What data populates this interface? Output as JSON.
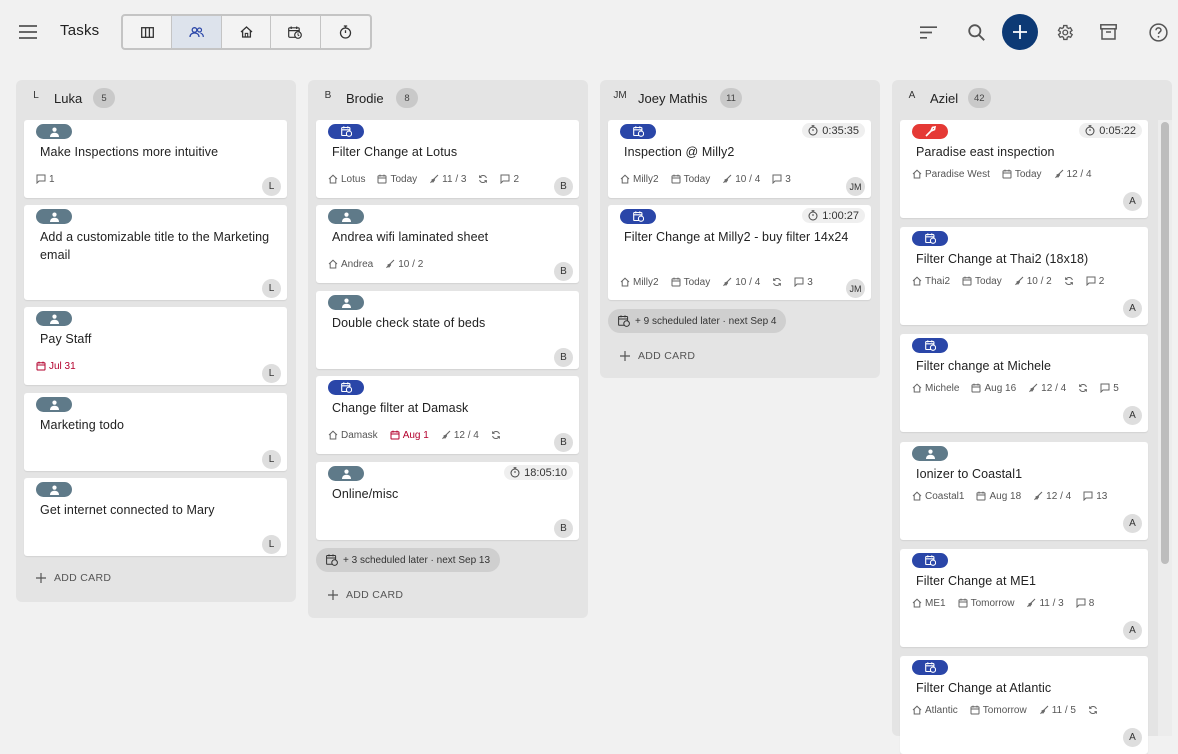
{
  "app": {
    "title": "Tasks",
    "brand_color": "#0d3a75"
  },
  "toolbar": {
    "view_icons": [
      "board-icon",
      "people-icon",
      "home-icon",
      "calendar-clock-icon",
      "stopwatch-icon"
    ],
    "active_view": 1,
    "right_icons": [
      "sort-icon",
      "search-icon",
      "add-icon",
      "gear-icon",
      "archive-icon",
      "help-icon"
    ]
  },
  "colors": {
    "pill_person": "#5f7a89",
    "pill_schedule": "#2a46a8",
    "pill_repair": "#e53935",
    "overdue": "#b3002d"
  },
  "columns": [
    {
      "initial": "L",
      "name": "Luka",
      "count": "5",
      "add_label": "ADD CARD",
      "cards": [
        {
          "type": "person",
          "title": "Make Inspections more intuitive",
          "meta": {
            "comments": "1"
          },
          "assignee": "L"
        },
        {
          "type": "person",
          "title": "Add a customizable title to the Marketing email",
          "meta": {},
          "assignee": "L"
        },
        {
          "type": "person",
          "title": "Pay Staff",
          "meta": {
            "date": "Jul 31",
            "date_overdue": true
          },
          "assignee": "L"
        },
        {
          "type": "person",
          "title": "Marketing todo",
          "meta": {},
          "assignee": "L"
        },
        {
          "type": "person",
          "title": "Get internet connected to Mary",
          "meta": {},
          "assignee": "L"
        }
      ]
    },
    {
      "initial": "B",
      "name": "Brodie",
      "count": "8",
      "add_label": "ADD CARD",
      "scheduled": "+ 3 scheduled later · next Sep 13",
      "cards": [
        {
          "type": "schedule",
          "title": "Filter Change at Lotus",
          "meta": {
            "location": "Lotus",
            "date": "Today",
            "checklist": "11 / 3",
            "recurring": true,
            "comments": "2"
          },
          "assignee": "B"
        },
        {
          "type": "person",
          "title": "Andrea wifi laminated sheet",
          "meta": {
            "location": "Andrea",
            "checklist": "10 / 2"
          },
          "assignee": "B"
        },
        {
          "type": "person",
          "title": "Double check state of beds",
          "meta": {},
          "assignee": "B"
        },
        {
          "type": "schedule",
          "title": "Change filter at Damask",
          "meta": {
            "location": "Damask",
            "date": "Aug 1",
            "date_overdue": true,
            "checklist": "12 / 4",
            "recurring": true
          },
          "assignee": "B"
        },
        {
          "type": "person",
          "title": "Online/misc",
          "timer": "18:05:10",
          "meta": {},
          "assignee": "B"
        }
      ]
    },
    {
      "initial": "JM",
      "name": "Joey Mathis",
      "count": "11",
      "add_label": "ADD CARD",
      "scheduled": "+ 9 scheduled later · next Sep 4",
      "cards": [
        {
          "type": "schedule",
          "title": "Inspection @ Milly2",
          "timer": "0:35:35",
          "meta": {
            "location": "Milly2",
            "date": "Today",
            "checklist": "10 / 4",
            "comments": "3"
          },
          "assignee": "JM"
        },
        {
          "type": "schedule",
          "title": "Filter Change at  Milly2 - buy filter 14x24",
          "timer": "1:00:27",
          "meta": {
            "location": "Milly2",
            "date": "Today",
            "checklist": "10 / 4",
            "recurring": true,
            "comments": "3"
          },
          "assignee": "JM"
        }
      ]
    },
    {
      "initial": "A",
      "name": "Aziel",
      "count": "42",
      "cards": [
        {
          "type": "repair",
          "title": "Paradise east inspection",
          "timer": "0:05:22",
          "meta": {
            "location": "Paradise West",
            "date": "Today",
            "checklist": "12 / 4"
          },
          "assignee": "A"
        },
        {
          "type": "schedule",
          "title": "Filter Change at Thai2 (18x18)",
          "meta": {
            "location": "Thai2",
            "date": "Today",
            "checklist": "10 / 2",
            "recurring": true,
            "comments": "2"
          },
          "assignee": "A"
        },
        {
          "type": "schedule",
          "title": "Filter change at Michele",
          "meta": {
            "location": "Michele",
            "date": "Aug 16",
            "checklist": "12 / 4",
            "recurring": true,
            "comments": "5"
          },
          "assignee": "A"
        },
        {
          "type": "person",
          "title": "Ionizer to Coastal1",
          "meta": {
            "location": "Coastal1",
            "date": "Aug 18",
            "checklist": "12 / 4",
            "comments": "13"
          },
          "assignee": "A"
        },
        {
          "type": "schedule",
          "title": "Filter Change at ME1",
          "meta": {
            "location": "ME1",
            "date": "Tomorrow",
            "checklist": "11 / 3",
            "comments": "8"
          },
          "assignee": "A"
        },
        {
          "type": "schedule",
          "title": "Filter Change at Atlantic",
          "meta": {
            "location": "Atlantic",
            "date": "Tomorrow",
            "checklist": "11 / 5",
            "recurring": true
          },
          "assignee": "A"
        }
      ]
    }
  ]
}
